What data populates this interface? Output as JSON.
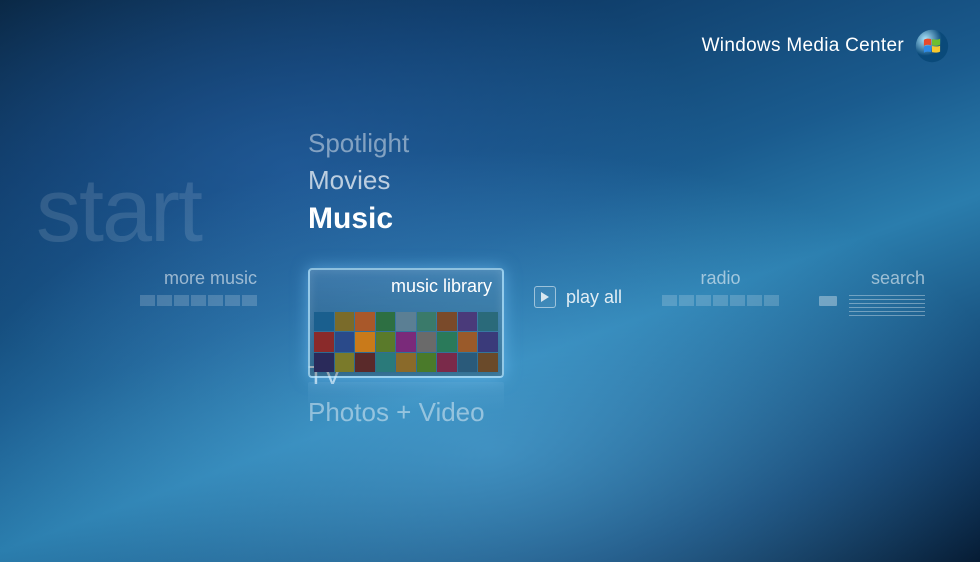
{
  "header": {
    "title": "Windows Media Center"
  },
  "start_label": "start",
  "vertical_menu": {
    "items": [
      {
        "label": "Spotlight"
      },
      {
        "label": "Movies"
      },
      {
        "label": "Music",
        "active": true
      },
      {
        "label": "TV"
      },
      {
        "label": "Photos + Video"
      }
    ]
  },
  "horizontal_row": {
    "more_music": {
      "label": "more music"
    },
    "music_library": {
      "label": "music library"
    },
    "play_all": {
      "label": "play all"
    },
    "radio": {
      "label": "radio"
    },
    "search": {
      "label": "search"
    }
  },
  "album_colors": [
    "#1a5f8e",
    "#7a6b2a",
    "#a9582a",
    "#2d6f42",
    "#5b7f94",
    "#3a7a6a",
    "#7a4a2a",
    "#4a3a7a",
    "#2a6a7a",
    "#8a2a2a",
    "#2a4a8a",
    "#c97a1a",
    "#5a7a2a",
    "#7a2a7a",
    "#6a6a6a",
    "#2a7a5a",
    "#9a5a2a",
    "#3a3a7a",
    "#2a2a5a",
    "#7a7a2a",
    "#5a2a2a",
    "#2a7a7a",
    "#8a6a2a",
    "#4a7a2a",
    "#7a2a4a",
    "#2a5a7a",
    "#6a4a2a"
  ]
}
